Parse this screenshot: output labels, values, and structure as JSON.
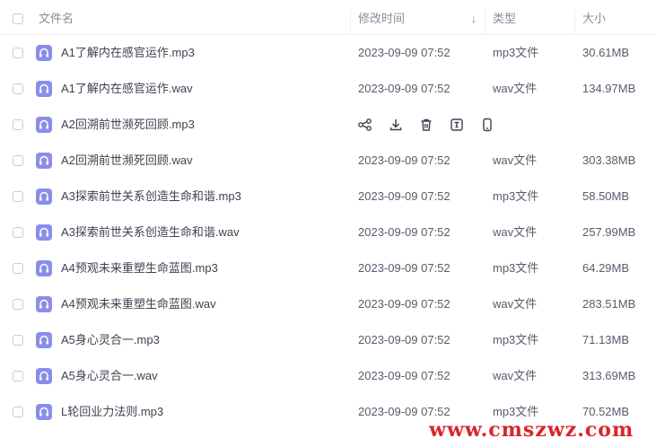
{
  "columns": {
    "name": "文件名",
    "modified": "修改时间",
    "type": "类型",
    "size": "大小"
  },
  "rows": [
    {
      "name": "A1了解内在感官运作.mp3",
      "date": "2023-09-09 07:52",
      "type": "mp3文件",
      "size": "30.61MB"
    },
    {
      "name": "A1了解内在感官运作.wav",
      "date": "2023-09-09 07:52",
      "type": "wav文件",
      "size": "134.97MB"
    },
    {
      "name": "A2回溯前世濒死回顾.mp3",
      "date": "",
      "type": "",
      "size": "",
      "hovered": true
    },
    {
      "name": "A2回溯前世濒死回顾.wav",
      "date": "2023-09-09 07:52",
      "type": "wav文件",
      "size": "303.38MB"
    },
    {
      "name": "A3探索前世关系创造生命和谐.mp3",
      "date": "2023-09-09 07:52",
      "type": "mp3文件",
      "size": "58.50MB"
    },
    {
      "name": "A3探索前世关系创造生命和谐.wav",
      "date": "2023-09-09 07:52",
      "type": "wav文件",
      "size": "257.99MB"
    },
    {
      "name": "A4预观未来重塑生命蓝图.mp3",
      "date": "2023-09-09 07:52",
      "type": "mp3文件",
      "size": "64.29MB"
    },
    {
      "name": "A4预观未来重塑生命蓝图.wav",
      "date": "2023-09-09 07:52",
      "type": "wav文件",
      "size": "283.51MB"
    },
    {
      "name": "A5身心灵合一.mp3",
      "date": "2023-09-09 07:52",
      "type": "mp3文件",
      "size": "71.13MB"
    },
    {
      "name": "A5身心灵合一.wav",
      "date": "2023-09-09 07:52",
      "type": "wav文件",
      "size": "313.69MB"
    },
    {
      "name": "L轮回业力法则.mp3",
      "date": "2023-09-09 07:52",
      "type": "mp3文件",
      "size": "70.52MB"
    }
  ],
  "hover_actions": [
    "share-icon",
    "download-icon",
    "delete-icon",
    "rename-icon",
    "phone-icon"
  ],
  "file_icon": "audio-file-icon",
  "watermark": "www.cmszwz.com",
  "colors": {
    "file_icon": "#8a8ee8",
    "sort_arrow": "#3e78d6",
    "watermark": "#d8262c"
  }
}
